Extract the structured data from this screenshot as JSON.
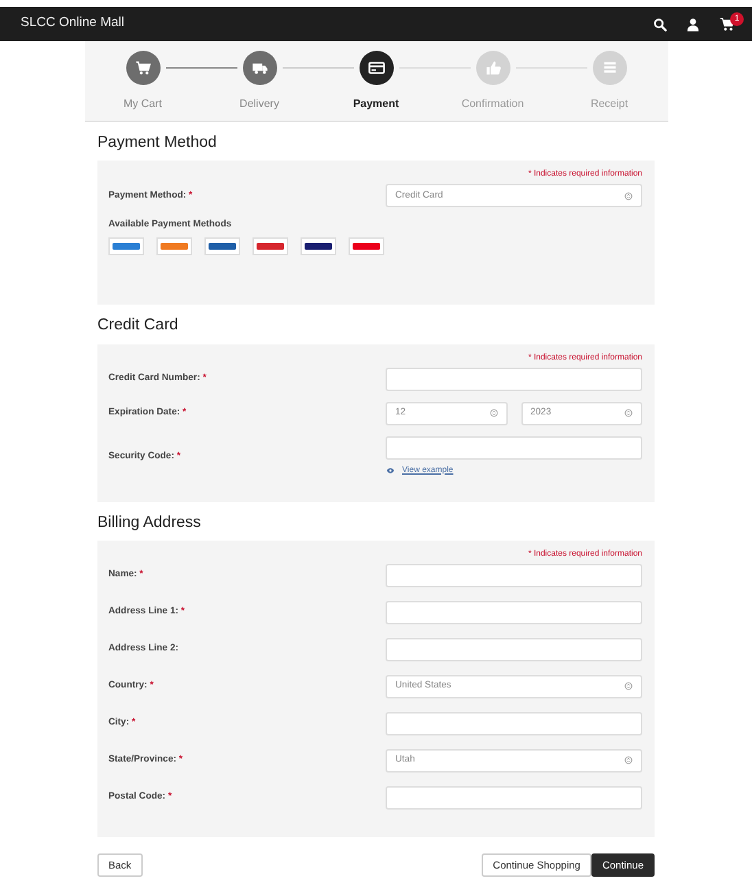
{
  "navbar": {
    "title": "SLCC Online Mall",
    "cart_badge": "1"
  },
  "steps": [
    {
      "label": "My Cart",
      "kind": "cart",
      "completed": true,
      "selected": false
    },
    {
      "label": "Delivery",
      "kind": "truck",
      "completed": true,
      "selected": false
    },
    {
      "label": "Payment",
      "kind": "card",
      "completed": false,
      "selected": true
    },
    {
      "label": "Confirmation",
      "kind": "thumb",
      "completed": false,
      "selected": false
    },
    {
      "label": "Receipt",
      "kind": "list",
      "completed": false,
      "selected": false
    }
  ],
  "sections": [
    {
      "title": "Payment Method",
      "required_note": "* Indicates required information",
      "rows": [
        {
          "label": "Payment Method:",
          "mark": "*",
          "fields": [
            {
              "kind": "select",
              "value": "Credit Card"
            }
          ]
        }
      ],
      "methods_title": "Available Payment Methods",
      "methods": [
        {
          "color": "#2a7fd4"
        },
        {
          "color": "#f07a21"
        },
        {
          "color": "#1f5fa8"
        },
        {
          "color": "#d6262e"
        },
        {
          "color": "#1a1f71"
        },
        {
          "color": "#eb001b"
        }
      ]
    },
    {
      "title": "Credit Card",
      "required_note": "* Indicates required information",
      "rows": [
        {
          "label": "Credit Card Number:",
          "mark": "*",
          "fields": [
            {
              "kind": "text"
            }
          ]
        },
        {
          "label": "Expiration Date:",
          "mark": "*",
          "fields": [
            {
              "kind": "select",
              "value": "12"
            },
            {
              "kind": "select",
              "value": "2023"
            }
          ]
        },
        {
          "label": "Security Code:",
          "mark": "*",
          "fields": [
            {
              "kind": "text"
            }
          ],
          "link": "View example"
        }
      ]
    },
    {
      "title": "Billing Address",
      "required_note": "* Indicates required information",
      "rows": [
        {
          "label": "Name:",
          "mark": "*",
          "fields": [
            {
              "kind": "text"
            }
          ]
        },
        {
          "label": "Address Line 1:",
          "mark": "*",
          "fields": [
            {
              "kind": "text"
            }
          ]
        },
        {
          "label": "Address Line 2:",
          "fields": [
            {
              "kind": "text"
            }
          ]
        },
        {
          "label": "Country:",
          "mark": "*",
          "fields": [
            {
              "kind": "select",
              "value": "United States"
            }
          ]
        },
        {
          "label": "City:",
          "mark": "*",
          "fields": [
            {
              "kind": "text"
            }
          ]
        },
        {
          "label": "State/Province:",
          "mark": "*",
          "fields": [
            {
              "kind": "select",
              "value": "Utah"
            }
          ]
        },
        {
          "label": "Postal Code:",
          "mark": "*",
          "fields": [
            {
              "kind": "text"
            }
          ]
        }
      ]
    }
  ],
  "buttons": [
    {
      "label": "Back",
      "primary": false
    },
    {
      "label": "Continue Shopping",
      "primary": false
    },
    {
      "label": "Continue",
      "primary": true
    }
  ]
}
